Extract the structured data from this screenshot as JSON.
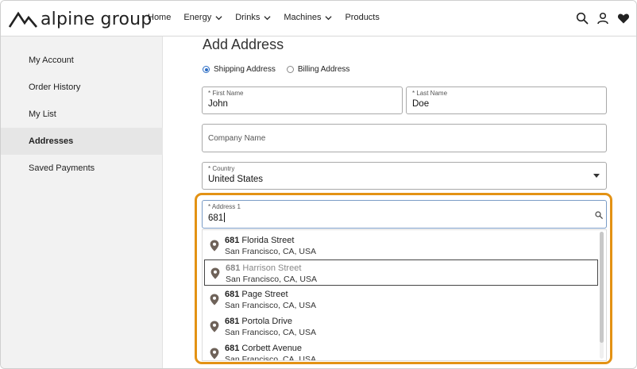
{
  "header": {
    "logo_text": "alpine group",
    "nav": [
      {
        "label": "Home",
        "has_dropdown": false
      },
      {
        "label": "Energy",
        "has_dropdown": true
      },
      {
        "label": "Drinks",
        "has_dropdown": true
      },
      {
        "label": "Machines",
        "has_dropdown": true
      },
      {
        "label": "Products",
        "has_dropdown": false
      }
    ],
    "icons": [
      "search-icon",
      "user-icon",
      "heart-icon"
    ]
  },
  "sidebar": {
    "items": [
      {
        "label": "My Account",
        "active": false
      },
      {
        "label": "Order History",
        "active": false
      },
      {
        "label": "My List",
        "active": false
      },
      {
        "label": "Addresses",
        "active": true
      },
      {
        "label": "Saved Payments",
        "active": false
      }
    ]
  },
  "form": {
    "title": "Add Address",
    "address_type": {
      "options": [
        "Shipping Address",
        "Billing Address"
      ],
      "selected": "Shipping Address"
    },
    "first_name": {
      "label": "* First Name",
      "value": "John"
    },
    "last_name": {
      "label": "* Last Name",
      "value": "Doe"
    },
    "company": {
      "placeholder": "Company Name",
      "value": ""
    },
    "country": {
      "label": "* Country",
      "value": "United States"
    },
    "address1": {
      "label": "* Address 1",
      "value": "681"
    }
  },
  "suggestions": [
    {
      "match": "681",
      "street": " Florida Street",
      "locality": "San Francisco, CA, USA",
      "hovered": false
    },
    {
      "match": "681",
      "street": " Harrison Street",
      "locality": "San Francisco, CA, USA",
      "hovered": true
    },
    {
      "match": "681",
      "street": " Page Street",
      "locality": "San Francisco, CA, USA",
      "hovered": false
    },
    {
      "match": "681",
      "street": " Portola Drive",
      "locality": "San Francisco, CA, USA",
      "hovered": false
    },
    {
      "match": "681",
      "street": " Corbett Avenue",
      "locality": "San Francisco, CA, USA",
      "hovered": false
    }
  ],
  "colors": {
    "highlight": "#e39214",
    "radio_accent": "#2b6cc4",
    "sidebar_bg": "#f2f2f2",
    "pin": "#6e6259"
  }
}
